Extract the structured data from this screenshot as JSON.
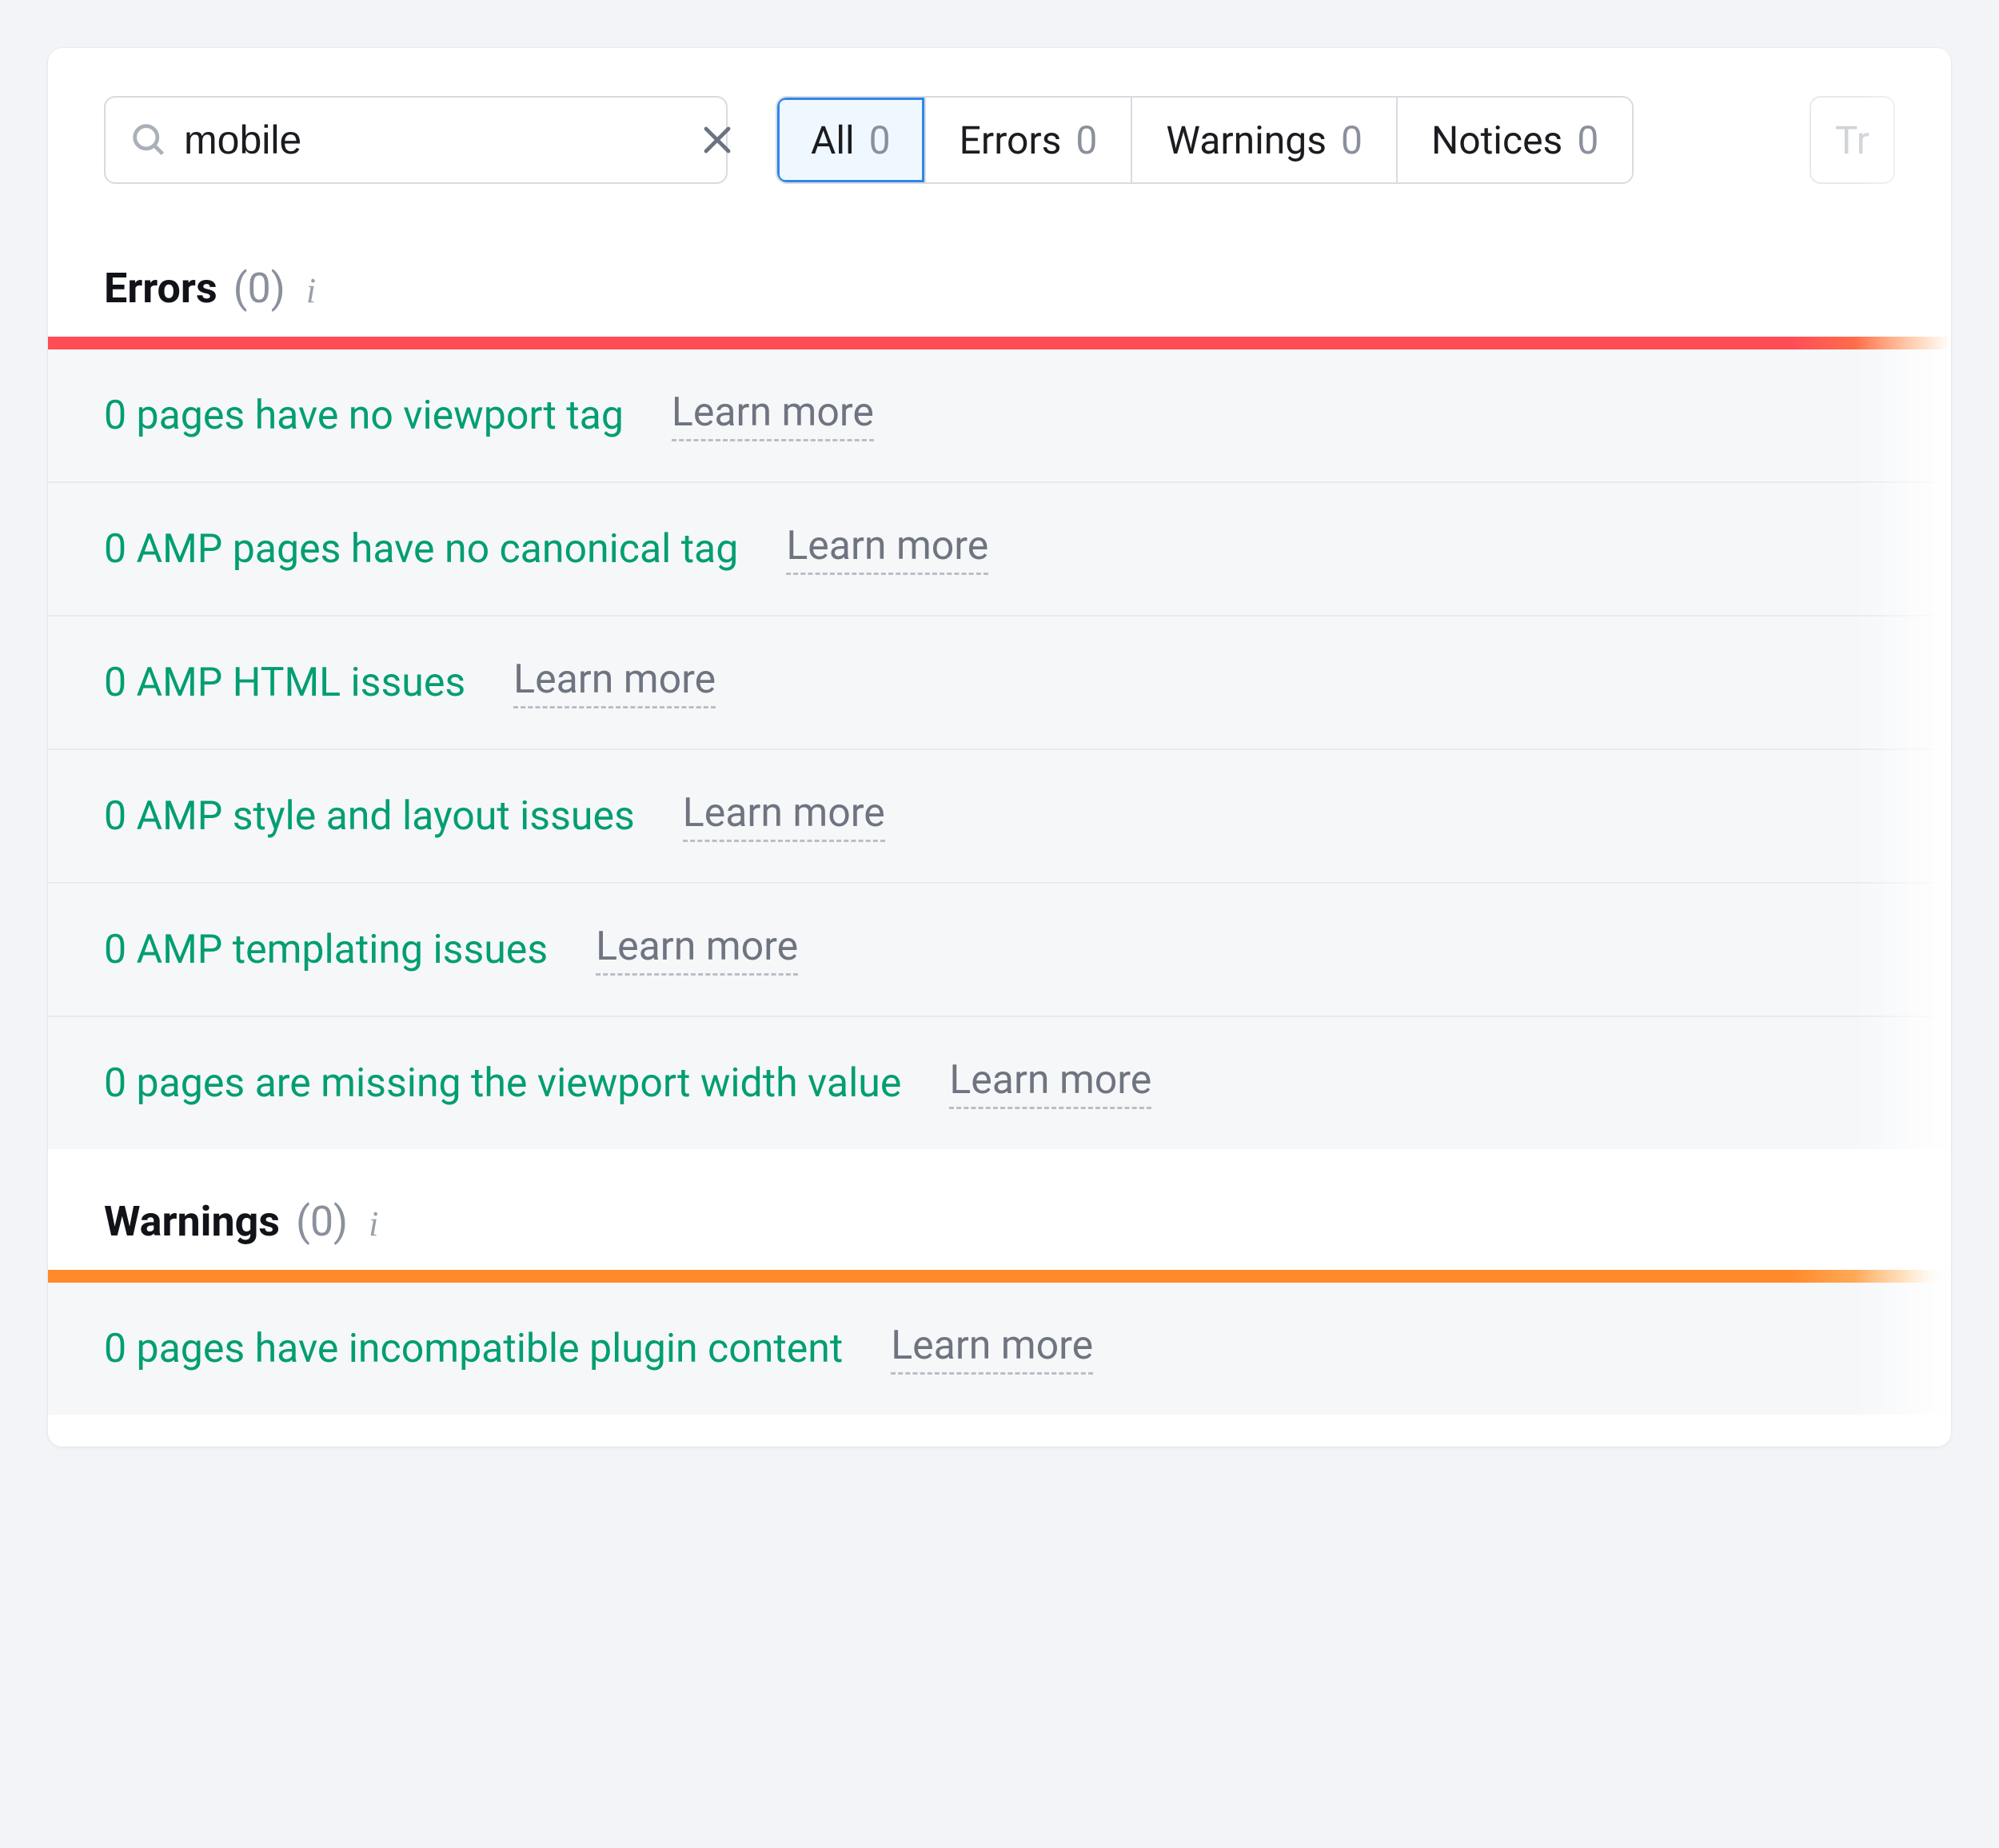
{
  "search": {
    "value": "mobile",
    "placeholder": ""
  },
  "filters": {
    "all": {
      "label": "All",
      "count": "0"
    },
    "errors": {
      "label": "Errors",
      "count": "0"
    },
    "warnings": {
      "label": "Warnings",
      "count": "0"
    },
    "notices": {
      "label": "Notices",
      "count": "0"
    }
  },
  "ghost_button": "Tr",
  "sections": {
    "errors": {
      "title": "Errors",
      "count": "(0)"
    },
    "warnings": {
      "title": "Warnings",
      "count": "(0)"
    }
  },
  "learn_more": "Learn more",
  "error_items": [
    "0 pages have no viewport tag",
    "0 AMP pages have no canonical tag",
    "0 AMP HTML issues",
    "0 AMP style and layout issues",
    "0 AMP templating issues",
    "0 pages are missing the viewport width value"
  ],
  "warning_items": [
    "0 pages have incompatible plugin content"
  ]
}
